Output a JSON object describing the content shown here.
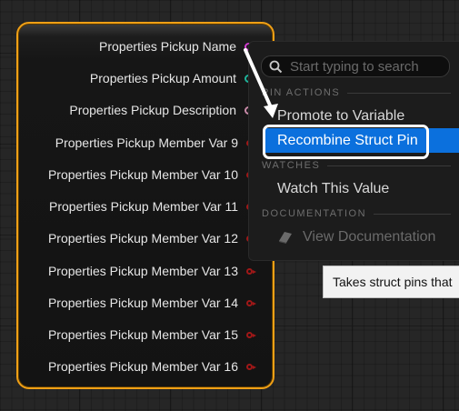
{
  "colors": {
    "node_border": "#f0a016",
    "selected_bg": "#0b70dd",
    "pin_magenta": "#c247c2",
    "pin_teal": "#1fb39a",
    "pin_pink": "#c88aa8",
    "pin_red": "#a01818"
  },
  "node": {
    "pins": [
      {
        "label": "Properties Pickup Name",
        "color": "#d13ccf",
        "kind": "circle"
      },
      {
        "label": "Properties Pickup Amount",
        "color": "#1fb39a",
        "kind": "circle"
      },
      {
        "label": "Properties Pickup Description",
        "color": "#c88aa8",
        "kind": "circle"
      },
      {
        "label": "Properties Pickup Member Var 9",
        "color": "#a01818",
        "kind": "struct"
      },
      {
        "label": "Properties Pickup Member Var 10",
        "color": "#a01818",
        "kind": "struct"
      },
      {
        "label": "Properties Pickup Member Var 11",
        "color": "#a01818",
        "kind": "struct"
      },
      {
        "label": "Properties Pickup Member Var 12",
        "color": "#a01818",
        "kind": "struct"
      },
      {
        "label": "Properties Pickup Member Var 13",
        "color": "#a01818",
        "kind": "struct"
      },
      {
        "label": "Properties Pickup Member Var 14",
        "color": "#a01818",
        "kind": "struct"
      },
      {
        "label": "Properties Pickup Member Var 15",
        "color": "#a01818",
        "kind": "struct"
      },
      {
        "label": "Properties Pickup Member Var 16",
        "color": "#a01818",
        "kind": "struct"
      }
    ]
  },
  "menu": {
    "search_placeholder": "Start typing to search",
    "section_pin_actions": "PIN ACTIONS",
    "promote": "Promote to Variable",
    "recombine": "Recombine Struct Pin",
    "section_watches": "WATCHES",
    "watch": "Watch This Value",
    "section_documentation": "DOCUMENTATION",
    "view_docs": "View Documentation"
  },
  "tooltip": {
    "text": "Takes struct pins that"
  },
  "icons": {
    "search": "search-icon",
    "docs": "book-icon",
    "pointer": "arrow-annotation"
  }
}
